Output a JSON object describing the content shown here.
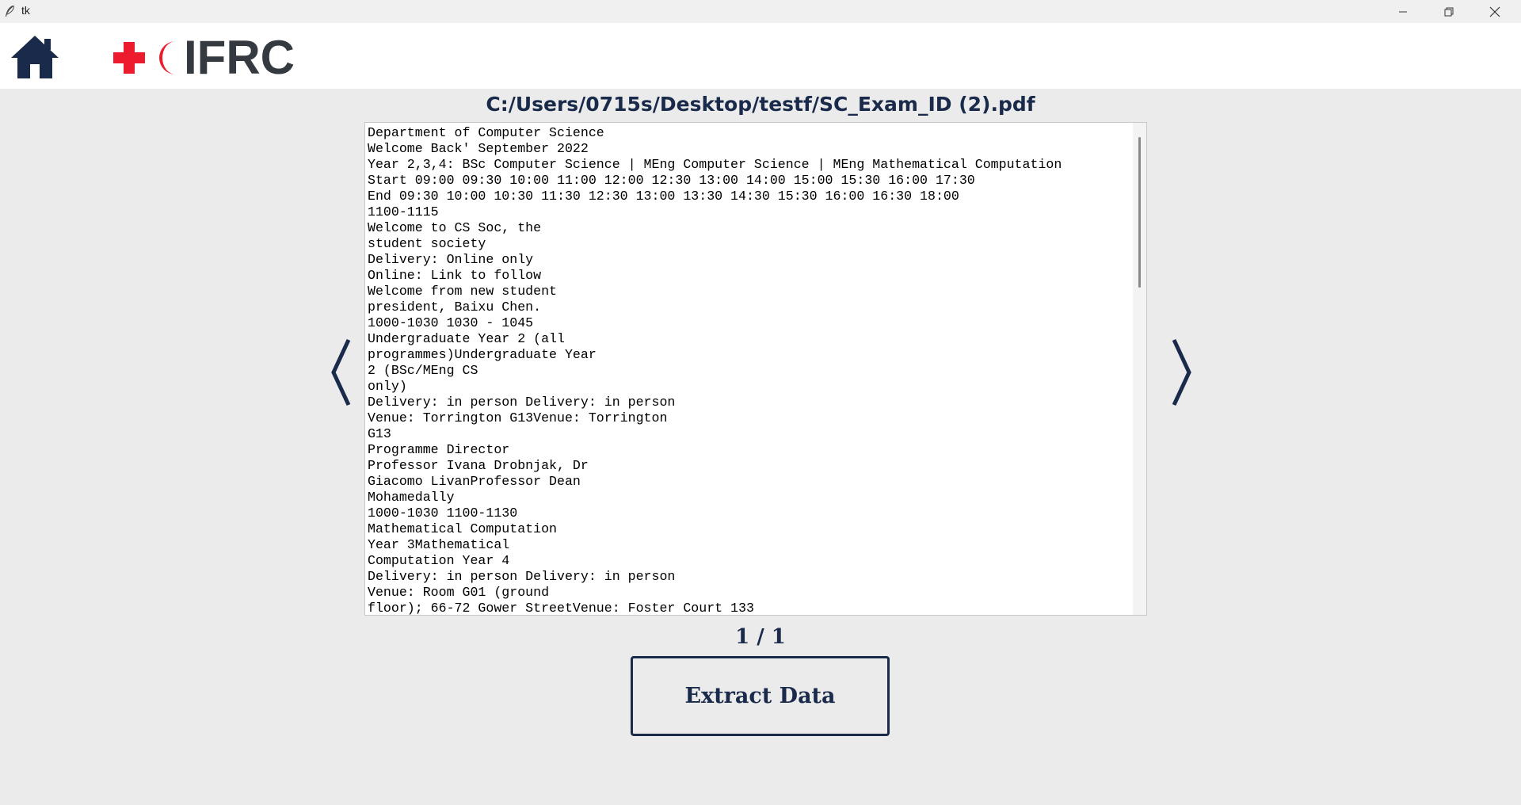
{
  "window": {
    "title": "tk",
    "icons": {
      "app": "feather-icon",
      "minimize": "minimize-icon",
      "maximize": "restore-icon",
      "close": "close-icon"
    }
  },
  "header": {
    "home_icon": "home-icon",
    "logo_text": "IFRC",
    "colors": {
      "brand_red": "#ed1b2e",
      "logo_text": "#343a40",
      "home": "#1a2a4a"
    }
  },
  "viewer": {
    "file_path": "C:/Users/0715s/Desktop/testf/SC_Exam_ID (2).pdf",
    "content": "Department of Computer Science\nWelcome Back' September 2022\nYear 2,3,4: BSc Computer Science | MEng Computer Science | MEng Mathematical Computation\nStart 09:00 09:30 10:00 11:00 12:00 12:30 13:00 14:00 15:00 15:30 16:00 17:30\nEnd 09:30 10:00 10:30 11:30 12:30 13:00 13:30 14:30 15:30 16:00 16:30 18:00\n1100-1115\nWelcome to CS Soc, the\nstudent society\nDelivery: Online only\nOnline: Link to follow\nWelcome from new student\npresident, Baixu Chen.\n1000-1030 1030 - 1045\nUndergraduate Year 2 (all\nprogrammes)Undergraduate Year\n2 (BSc/MEng CS\nonly)\nDelivery: in person Delivery: in person\nVenue: Torrington G13Venue: Torrington\nG13\nProgramme Director\nProfessor Ivana Drobnjak, Dr\nGiacomo LivanProfessor Dean\nMohamedally\n1000-1030 1100-1130\nMathematical Computation\nYear 3Mathematical\nComputation Year 4\nDelivery: in person Delivery: in person\nVenue: Room G01 (ground\nfloor); 66-72 Gower StreetVenue: Foster Court 133",
    "prev_icon": "chevron-left-icon",
    "next_icon": "chevron-right-icon",
    "page_indicator": "1 / 1"
  },
  "actions": {
    "extract_label": "Extract Data"
  },
  "colors": {
    "background": "#ebebeb",
    "accent_navy": "#1a2a4a"
  }
}
